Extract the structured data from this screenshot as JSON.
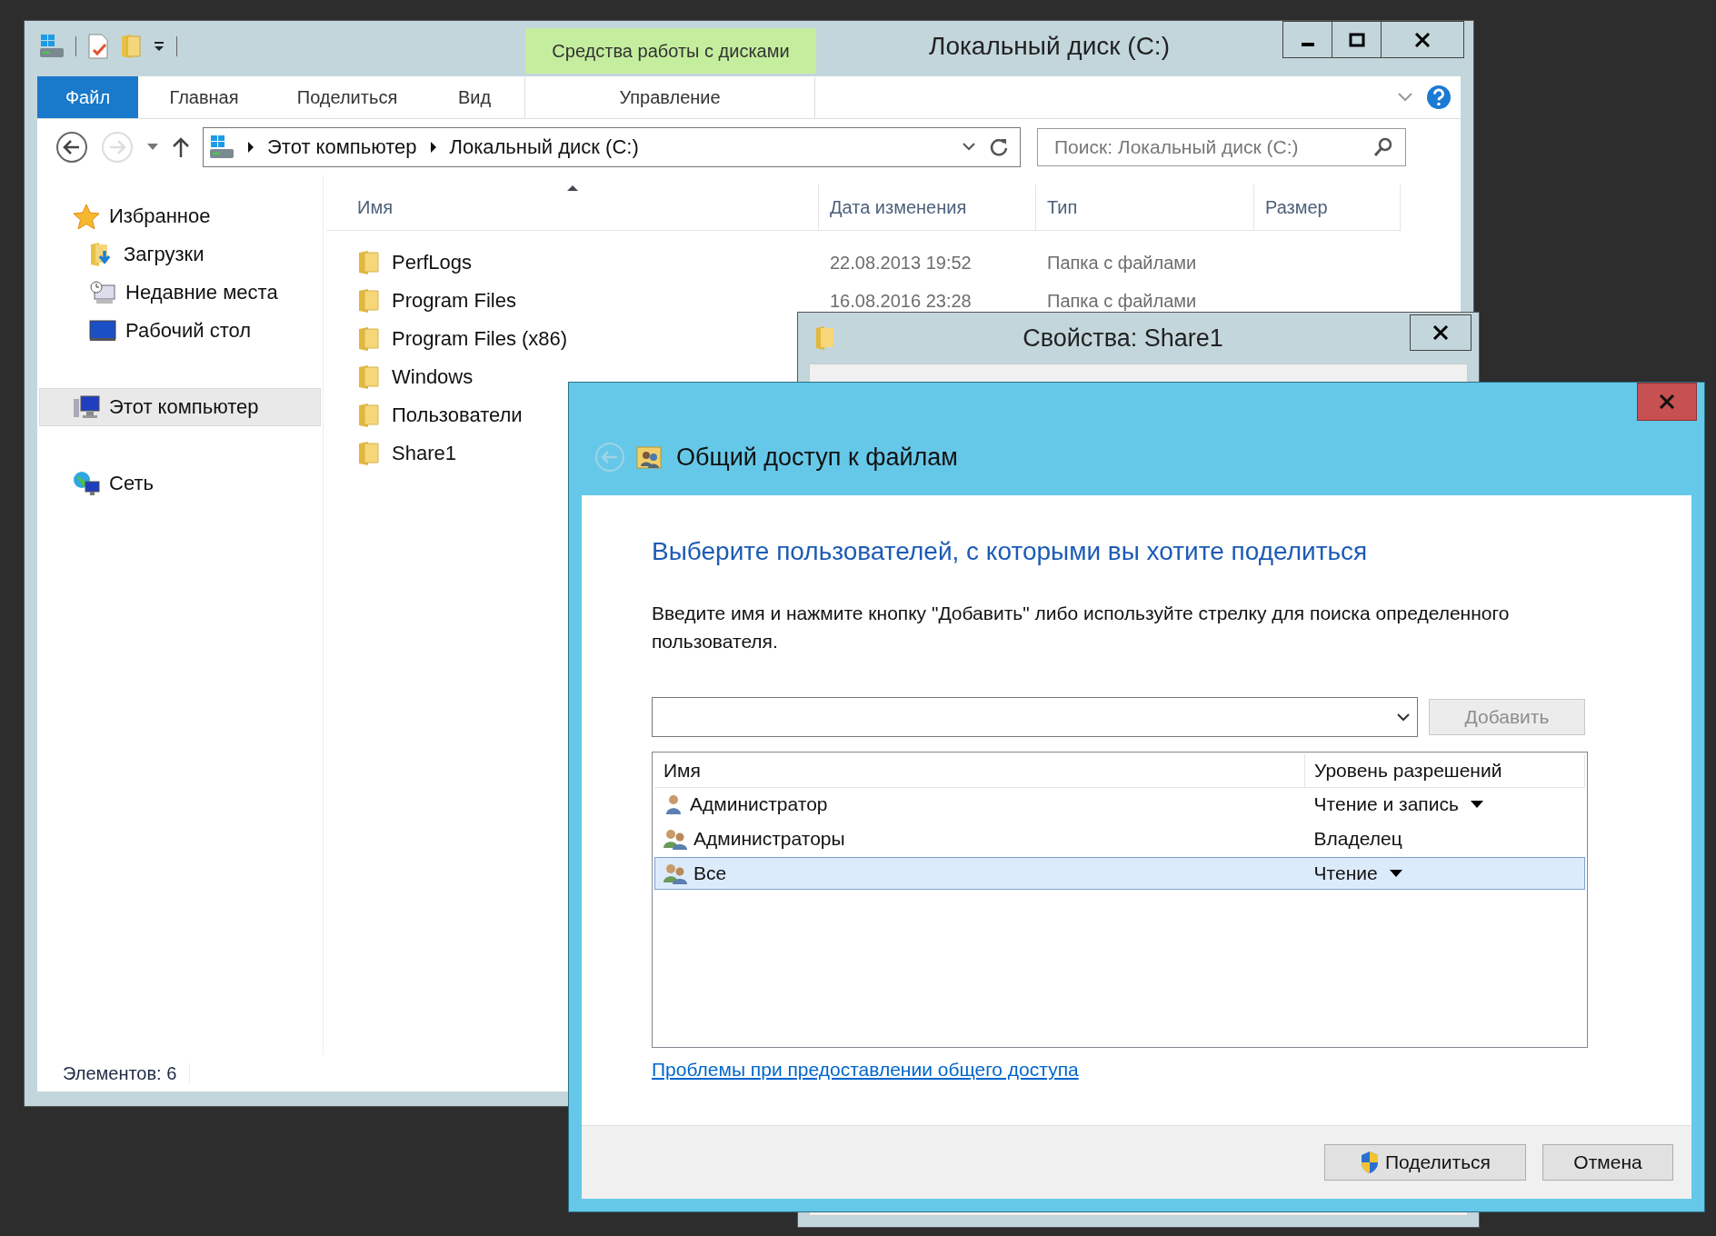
{
  "explorer": {
    "title": "Локальный диск (C:)",
    "context_group": "Средства работы с дисками",
    "ribbon_tabs": [
      {
        "label": "Файл",
        "kind": "file",
        "selected": false
      },
      {
        "label": "Главная",
        "kind": "normal",
        "selected": false
      },
      {
        "label": "Поделиться",
        "kind": "normal",
        "selected": false
      },
      {
        "label": "Вид",
        "kind": "normal",
        "selected": false
      },
      {
        "label": "Управление",
        "kind": "context",
        "selected": false
      }
    ],
    "breadcrumbs": [
      "Этот компьютер",
      "Локальный диск (C:)"
    ],
    "search": {
      "placeholder": "Поиск: Локальный диск (C:)"
    },
    "navigation": [
      {
        "label": "Избранное",
        "kind": "favorites",
        "selected": false,
        "children": [
          {
            "label": "Загрузки",
            "kind": "downloads",
            "selected": false
          },
          {
            "label": "Недавние места",
            "kind": "recent",
            "selected": false
          },
          {
            "label": "Рабочий стол",
            "kind": "desktop",
            "selected": false
          }
        ]
      },
      {
        "label": "Этот компьютер",
        "kind": "computer",
        "selected": true
      },
      {
        "label": "Сеть",
        "kind": "network",
        "selected": false
      }
    ],
    "columns": [
      {
        "label": "Имя",
        "sorted": true
      },
      {
        "label": "Дата изменения",
        "sorted": false
      },
      {
        "label": "Тип",
        "sorted": false
      },
      {
        "label": "Размер",
        "sorted": false
      }
    ],
    "files": [
      {
        "name": "PerfLogs",
        "modified": "22.08.2013 19:52",
        "type": "Папка с файлами"
      },
      {
        "name": "Program Files",
        "modified": "16.08.2016 23:28",
        "type": "Папка с файлами"
      },
      {
        "name": "Program Files (x86)"
      },
      {
        "name": "Windows"
      },
      {
        "name": "Пользователи"
      },
      {
        "name": "Share1"
      }
    ],
    "status_bar": "Элементов: 6"
  },
  "properties_window": {
    "title": "Свойства: Share1"
  },
  "share_dialog": {
    "title": "Общий доступ к файлам",
    "heading": "Выберите пользователей, с которыми вы хотите поделиться",
    "instruction": "Введите имя и нажмите кнопку \"Добавить\" либо используйте стрелку для поиска определенного пользователя.",
    "add_button": {
      "label": "Добавить",
      "disabled": true
    },
    "columns": [
      "Имя",
      "Уровень разрешений"
    ],
    "users": [
      {
        "name": "Администратор",
        "kind": "user",
        "permission": "Чтение и запись",
        "dropdown": true,
        "selected": false
      },
      {
        "name": "Администраторы",
        "kind": "group",
        "permission": "Владелец",
        "dropdown": false,
        "selected": false
      },
      {
        "name": "Все",
        "kind": "group",
        "permission": "Чтение",
        "dropdown": true,
        "selected": true
      }
    ],
    "help_link": "Проблемы при предоставлении общего доступа",
    "buttons": [
      {
        "label": "Поделиться",
        "kind": "elevated"
      },
      {
        "label": "Отмена",
        "kind": "plain"
      }
    ]
  }
}
